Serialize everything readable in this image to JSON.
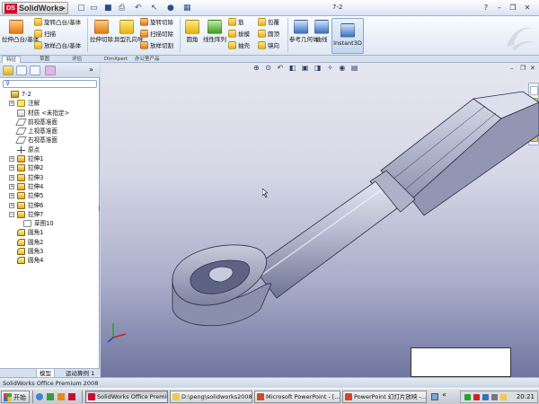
{
  "app": {
    "brand": "SolidWorks",
    "brand_mark": "DS",
    "document_title": "7-2"
  },
  "ribbon": {
    "groups": [
      {
        "label": "拉伸凸台/基体",
        "icon": "extruded-boss-icon"
      },
      {
        "label": "旋转凸台/基体",
        "icon": "revolved-boss-icon"
      },
      {
        "label": "扫描",
        "icon": "swept-boss-icon"
      },
      {
        "label": "放样凸台/基体",
        "icon": "lofted-boss-icon"
      },
      {
        "label": "拉伸切除",
        "icon": "extruded-cut-icon"
      },
      {
        "label": "异型孔向导",
        "icon": "hole-wizard-icon"
      },
      {
        "label": "旋转切除",
        "icon": "revolved-cut-icon"
      },
      {
        "label": "扫描切除",
        "icon": "swept-cut-icon"
      },
      {
        "label": "放样切割",
        "icon": "lofted-cut-icon"
      },
      {
        "label": "圆角",
        "icon": "fillet-icon"
      },
      {
        "label": "线性阵列",
        "icon": "linear-pattern-icon"
      },
      {
        "label": "筋",
        "icon": "rib-icon"
      },
      {
        "label": "拔模",
        "icon": "draft-icon"
      },
      {
        "label": "抽壳",
        "icon": "shell-icon"
      },
      {
        "label": "包覆",
        "icon": "wrap-icon"
      },
      {
        "label": "圆顶",
        "icon": "dome-icon"
      },
      {
        "label": "镜向",
        "icon": "mirror-icon"
      },
      {
        "label": "参考几何体",
        "icon": "reference-geometry-icon"
      },
      {
        "label": "曲线",
        "icon": "curves-icon"
      },
      {
        "label": "Instant3D",
        "icon": "instant3d-icon"
      }
    ]
  },
  "command_tabs": [
    {
      "label": "特征",
      "active": true
    },
    {
      "label": "草图",
      "active": false
    },
    {
      "label": "评估",
      "active": false
    },
    {
      "label": "DimXpert",
      "active": false
    },
    {
      "label": "办公室产品",
      "active": false
    }
  ],
  "feature_tree": [
    {
      "label": "7-2",
      "icon": "part-icon",
      "level": 0,
      "expander": ""
    },
    {
      "label": "注解",
      "icon": "annotations-icon",
      "level": 1,
      "expander": "+"
    },
    {
      "label": "材质 <未指定>",
      "icon": "material-icon",
      "level": 1,
      "expander": ""
    },
    {
      "label": "前视基准面",
      "icon": "plane-icon",
      "level": 1,
      "expander": ""
    },
    {
      "label": "上视基准面",
      "icon": "plane-icon",
      "level": 1,
      "expander": ""
    },
    {
      "label": "右视基准面",
      "icon": "plane-icon",
      "level": 1,
      "expander": ""
    },
    {
      "label": "原点",
      "icon": "origin-icon",
      "level": 1,
      "expander": ""
    },
    {
      "label": "拉伸1",
      "icon": "extrude-icon",
      "level": 1,
      "expander": "+"
    },
    {
      "label": "拉伸2",
      "icon": "extrude-icon",
      "level": 1,
      "expander": "+"
    },
    {
      "label": "拉伸3",
      "icon": "extrude-icon",
      "level": 1,
      "expander": "+"
    },
    {
      "label": "拉伸4",
      "icon": "extrude-icon",
      "level": 1,
      "expander": "+"
    },
    {
      "label": "拉伸5",
      "icon": "extrude-icon",
      "level": 1,
      "expander": "+"
    },
    {
      "label": "拉伸6",
      "icon": "extrude-icon",
      "level": 1,
      "expander": "+"
    },
    {
      "label": "拉伸7",
      "icon": "extrude-icon",
      "level": 1,
      "expander": "−"
    },
    {
      "label": "草图10",
      "icon": "sketch-icon",
      "level": 2,
      "expander": ""
    },
    {
      "label": "圆角1",
      "icon": "fillet-icon",
      "level": 1,
      "expander": ""
    },
    {
      "label": "圆角2",
      "icon": "fillet-icon",
      "level": 1,
      "expander": ""
    },
    {
      "label": "圆角3",
      "icon": "fillet-icon",
      "level": 1,
      "expander": ""
    },
    {
      "label": "圆角4",
      "icon": "fillet-icon",
      "level": 1,
      "expander": ""
    }
  ],
  "bottom_tabs": [
    {
      "label": "模型",
      "active": true
    },
    {
      "label": "运动算例 1",
      "active": false
    }
  ],
  "status": {
    "text": "SolidWorks Office Premium 2008"
  },
  "taskbar": {
    "start_label": "开始",
    "windows": [
      {
        "label": "SolidWorks Office Premiu...",
        "active": true,
        "icon": "solidworks-icon"
      },
      {
        "label": "D:\\peng\\solidworks2008",
        "active": false,
        "icon": "folder-icon"
      },
      {
        "label": "Microsoft PowerPoint - [...",
        "active": false,
        "icon": "powerpoint-icon"
      },
      {
        "label": "PowerPoint 幻灯片放映 -...",
        "active": false,
        "icon": "powerpoint-icon"
      }
    ],
    "clock": "20:21"
  },
  "colors": {
    "ribbon_bg": "#dfe8f4",
    "viewport_top": "#e6e6f0",
    "viewport_bottom": "#6f759f",
    "model_gray": "#a7abc2",
    "model_edge": "#2b2f44"
  }
}
